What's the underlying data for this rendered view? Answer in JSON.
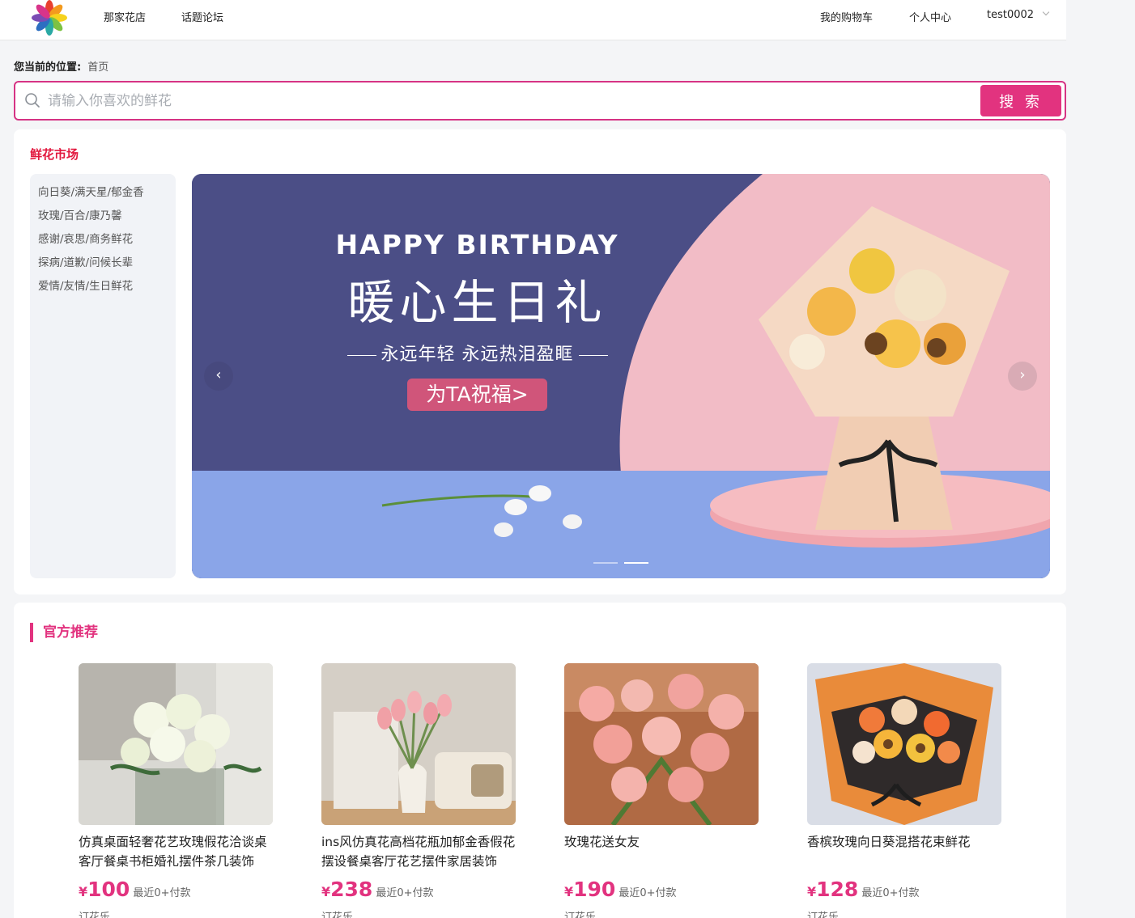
{
  "header": {
    "nav": [
      "那家花店",
      "话题论坛"
    ],
    "cart": "我的购物车",
    "profile": "个人中心",
    "username": "test0002"
  },
  "breadcrumb": {
    "label": "您当前的位置:",
    "current": "首页"
  },
  "search": {
    "placeholder": "请输入你喜欢的鲜花",
    "value": "",
    "button": "搜 索"
  },
  "market": {
    "title": "鲜花市场",
    "categories": [
      "向日葵/满天星/郁金香",
      "玫瑰/百合/康乃馨",
      "感谢/哀思/商务鲜花",
      "探病/道歉/问候长辈",
      "爱情/友情/生日鲜花"
    ]
  },
  "banner": {
    "title_en": "HAPPY BIRTHDAY",
    "title_cn": "暖心生日礼",
    "subtitle": "永远年轻  永远热泪盈眶",
    "cta": "为TA祝福>",
    "prev": "‹",
    "next": "›",
    "slide_count": 2,
    "active_slide": 2
  },
  "recommend": {
    "title": "官方推荐",
    "currency": "¥",
    "products": [
      {
        "name": "仿真桌面轻奢花艺玫瑰假花洽谈桌客厅餐桌书柜婚礼摆件茶几装饰",
        "price": "100",
        "sales": "最近0+付款",
        "shop": "订花乐"
      },
      {
        "name": "ins风仿真花高档花瓶加郁金香假花摆设餐桌客厅花艺摆件家居装饰",
        "price": "238",
        "sales": "最近0+付款",
        "shop": "订花乐"
      },
      {
        "name": "玫瑰花送女友",
        "price": "190",
        "sales": "最近0+付款",
        "shop": "订花乐"
      },
      {
        "name": "香槟玫瑰向日葵混搭花束鲜花",
        "price": "128",
        "sales": "最近0+付款",
        "shop": "订花乐"
      }
    ]
  },
  "colors": {
    "accent": "#e2337f",
    "section_red": "#e2183e",
    "banner_bg": "#4b4e86",
    "banner_pink": "#f2bcc6",
    "banner_blue": "#8aa5e8"
  }
}
